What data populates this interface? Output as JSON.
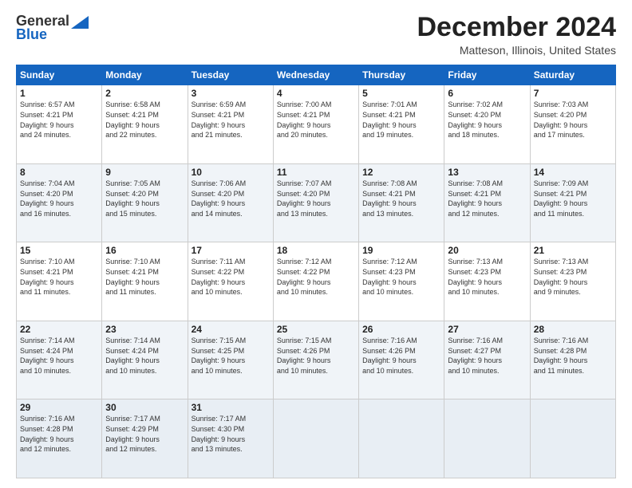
{
  "header": {
    "logo_general": "General",
    "logo_blue": "Blue",
    "month_title": "December 2024",
    "location": "Matteson, Illinois, United States"
  },
  "days_of_week": [
    "Sunday",
    "Monday",
    "Tuesday",
    "Wednesday",
    "Thursday",
    "Friday",
    "Saturday"
  ],
  "weeks": [
    [
      {
        "day": "1",
        "sunrise": "6:57 AM",
        "sunset": "4:21 PM",
        "daylight": "9 hours and 24 minutes."
      },
      {
        "day": "2",
        "sunrise": "6:58 AM",
        "sunset": "4:21 PM",
        "daylight": "9 hours and 22 minutes."
      },
      {
        "day": "3",
        "sunrise": "6:59 AM",
        "sunset": "4:21 PM",
        "daylight": "9 hours and 21 minutes."
      },
      {
        "day": "4",
        "sunrise": "7:00 AM",
        "sunset": "4:21 PM",
        "daylight": "9 hours and 20 minutes."
      },
      {
        "day": "5",
        "sunrise": "7:01 AM",
        "sunset": "4:21 PM",
        "daylight": "9 hours and 19 minutes."
      },
      {
        "day": "6",
        "sunrise": "7:02 AM",
        "sunset": "4:20 PM",
        "daylight": "9 hours and 18 minutes."
      },
      {
        "day": "7",
        "sunrise": "7:03 AM",
        "sunset": "4:20 PM",
        "daylight": "9 hours and 17 minutes."
      }
    ],
    [
      {
        "day": "8",
        "sunrise": "7:04 AM",
        "sunset": "4:20 PM",
        "daylight": "9 hours and 16 minutes."
      },
      {
        "day": "9",
        "sunrise": "7:05 AM",
        "sunset": "4:20 PM",
        "daylight": "9 hours and 15 minutes."
      },
      {
        "day": "10",
        "sunrise": "7:06 AM",
        "sunset": "4:20 PM",
        "daylight": "9 hours and 14 minutes."
      },
      {
        "day": "11",
        "sunrise": "7:07 AM",
        "sunset": "4:20 PM",
        "daylight": "9 hours and 13 minutes."
      },
      {
        "day": "12",
        "sunrise": "7:08 AM",
        "sunset": "4:21 PM",
        "daylight": "9 hours and 13 minutes."
      },
      {
        "day": "13",
        "sunrise": "7:08 AM",
        "sunset": "4:21 PM",
        "daylight": "9 hours and 12 minutes."
      },
      {
        "day": "14",
        "sunrise": "7:09 AM",
        "sunset": "4:21 PM",
        "daylight": "9 hours and 11 minutes."
      }
    ],
    [
      {
        "day": "15",
        "sunrise": "7:10 AM",
        "sunset": "4:21 PM",
        "daylight": "9 hours and 11 minutes."
      },
      {
        "day": "16",
        "sunrise": "7:10 AM",
        "sunset": "4:21 PM",
        "daylight": "9 hours and 11 minutes."
      },
      {
        "day": "17",
        "sunrise": "7:11 AM",
        "sunset": "4:22 PM",
        "daylight": "9 hours and 10 minutes."
      },
      {
        "day": "18",
        "sunrise": "7:12 AM",
        "sunset": "4:22 PM",
        "daylight": "9 hours and 10 minutes."
      },
      {
        "day": "19",
        "sunrise": "7:12 AM",
        "sunset": "4:23 PM",
        "daylight": "9 hours and 10 minutes."
      },
      {
        "day": "20",
        "sunrise": "7:13 AM",
        "sunset": "4:23 PM",
        "daylight": "9 hours and 10 minutes."
      },
      {
        "day": "21",
        "sunrise": "7:13 AM",
        "sunset": "4:23 PM",
        "daylight": "9 hours and 9 minutes."
      }
    ],
    [
      {
        "day": "22",
        "sunrise": "7:14 AM",
        "sunset": "4:24 PM",
        "daylight": "9 hours and 10 minutes."
      },
      {
        "day": "23",
        "sunrise": "7:14 AM",
        "sunset": "4:24 PM",
        "daylight": "9 hours and 10 minutes."
      },
      {
        "day": "24",
        "sunrise": "7:15 AM",
        "sunset": "4:25 PM",
        "daylight": "9 hours and 10 minutes."
      },
      {
        "day": "25",
        "sunrise": "7:15 AM",
        "sunset": "4:26 PM",
        "daylight": "9 hours and 10 minutes."
      },
      {
        "day": "26",
        "sunrise": "7:16 AM",
        "sunset": "4:26 PM",
        "daylight": "9 hours and 10 minutes."
      },
      {
        "day": "27",
        "sunrise": "7:16 AM",
        "sunset": "4:27 PM",
        "daylight": "9 hours and 10 minutes."
      },
      {
        "day": "28",
        "sunrise": "7:16 AM",
        "sunset": "4:28 PM",
        "daylight": "9 hours and 11 minutes."
      }
    ],
    [
      {
        "day": "29",
        "sunrise": "7:16 AM",
        "sunset": "4:28 PM",
        "daylight": "9 hours and 12 minutes."
      },
      {
        "day": "30",
        "sunrise": "7:17 AM",
        "sunset": "4:29 PM",
        "daylight": "9 hours and 12 minutes."
      },
      {
        "day": "31",
        "sunrise": "7:17 AM",
        "sunset": "4:30 PM",
        "daylight": "9 hours and 13 minutes."
      },
      {
        "day": "",
        "sunrise": "",
        "sunset": "",
        "daylight": ""
      },
      {
        "day": "",
        "sunrise": "",
        "sunset": "",
        "daylight": ""
      },
      {
        "day": "",
        "sunrise": "",
        "sunset": "",
        "daylight": ""
      },
      {
        "day": "",
        "sunrise": "",
        "sunset": "",
        "daylight": ""
      }
    ]
  ]
}
